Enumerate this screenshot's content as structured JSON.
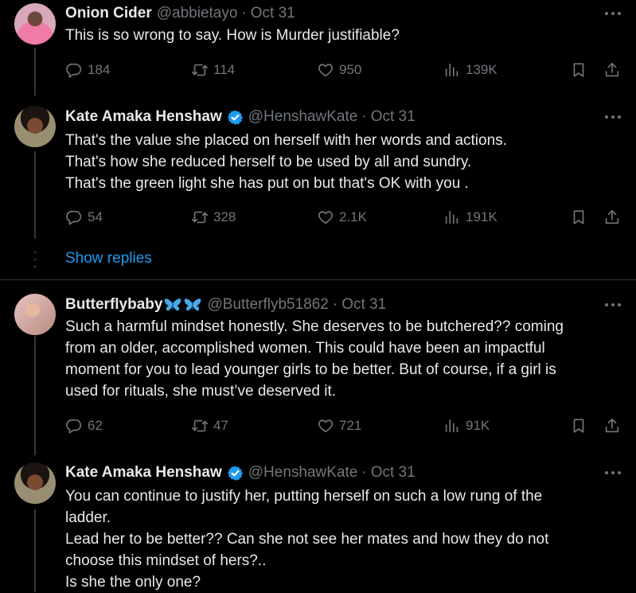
{
  "tweets": [
    {
      "name": "Onion Cider",
      "handle": "@abbietayo",
      "dot": "·",
      "date": "Oct 31",
      "verified": false,
      "lines": [
        "This is so wrong to say. How is Murder justifiable?"
      ],
      "replies": "184",
      "reposts": "114",
      "likes": "950",
      "views": "139K"
    },
    {
      "name": "Kate Amaka Henshaw",
      "handle": "@HenshawKate",
      "dot": "·",
      "date": "Oct 31",
      "verified": true,
      "lines": [
        "That's the value she placed on herself with her words and actions.",
        "That's how she reduced herself to be used by all and sundry.",
        "That's the green light she has put on but that's OK with you ."
      ],
      "replies": "54",
      "reposts": "328",
      "likes": "2.1K",
      "views": "191K"
    },
    {
      "name": "Butterflybaby",
      "handle": "@Butterflyb51862",
      "dot": "·",
      "date": "Oct 31",
      "verified": false,
      "emoji": "butterfly-emoji",
      "lines": [
        "Such a harmful mindset honestly. She deserves to be butchered?? coming",
        "from an older, accomplished women. This could have been an impactful",
        "moment for you to lead younger girls to be better. But of course, if a girl is",
        "used for rituals, she must’ve deserved it."
      ],
      "replies": "62",
      "reposts": "47",
      "likes": "721",
      "views": "91K"
    },
    {
      "name": "Kate Amaka Henshaw",
      "handle": "@HenshawKate",
      "dot": "·",
      "date": "Oct 31",
      "verified": true,
      "lines": [
        "You can continue to justify her, putting herself on such a low rung of the",
        "ladder.",
        "Lead her to be better?? Can she not see her mates and how they do not",
        "choose this mindset of hers?..",
        "Is she the only one?"
      ]
    }
  ],
  "show_replies": "Show replies",
  "colors": {
    "background": "#000000",
    "text": "#e7e9ea",
    "muted": "#71767b",
    "accent": "#1d9bf0",
    "divider": "#2f3336"
  }
}
